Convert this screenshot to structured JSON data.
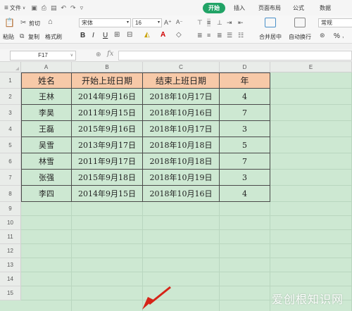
{
  "menubar": {
    "hamburger": "≡",
    "file_label": "文件",
    "tabs": [
      {
        "label": "开始",
        "active": true
      },
      {
        "label": "插入",
        "active": false
      },
      {
        "label": "页面布局",
        "active": false
      },
      {
        "label": "公式",
        "active": false
      },
      {
        "label": "数据",
        "active": false
      }
    ]
  },
  "ribbon": {
    "cut_label": "剪切",
    "paste_label": "粘贴",
    "copy_label": "复制",
    "format_painter_label": "格式刷",
    "font_name": "宋体",
    "font_size": "16",
    "bold": "B",
    "italic": "I",
    "underline": "U",
    "merge_label": "合并居中",
    "wrap_label": "自动换行",
    "number_format": "常规",
    "percent": "%"
  },
  "formula_bar": {
    "name_box": "F17",
    "fx_label": "fx",
    "value": ""
  },
  "sheet": {
    "columns": [
      "A",
      "B",
      "C",
      "D",
      "E"
    ],
    "row_numbers": [
      "1",
      "2",
      "3",
      "4",
      "5",
      "6",
      "7",
      "8",
      "9",
      "10",
      "11",
      "12",
      "13",
      "14",
      "15"
    ],
    "headers": [
      "姓名",
      "开始上班日期",
      "结束上班日期",
      "年"
    ],
    "rows": [
      [
        "王林",
        "2014年9月16日",
        "2018年10月17日",
        "4"
      ],
      [
        "李昊",
        "2011年9月15日",
        "2018年10月16日",
        "7"
      ],
      [
        "王磊",
        "2015年9月16日",
        "2018年10月17日",
        "3"
      ],
      [
        "吴雪",
        "2013年9月17日",
        "2018年10月18日",
        "5"
      ],
      [
        "林雪",
        "2011年9月17日",
        "2018年10月18日",
        "7"
      ],
      [
        "张强",
        "2015年9月18日",
        "2018年10月19日",
        "3"
      ],
      [
        "李四",
        "2014年9月15日",
        "2018年10月16日",
        "4"
      ]
    ]
  },
  "watermark": "爱创根知识网",
  "colors": {
    "sheet_bg": "#cde8d2",
    "header_fill": "#f7c9a8",
    "active_tab": "#21a366"
  }
}
